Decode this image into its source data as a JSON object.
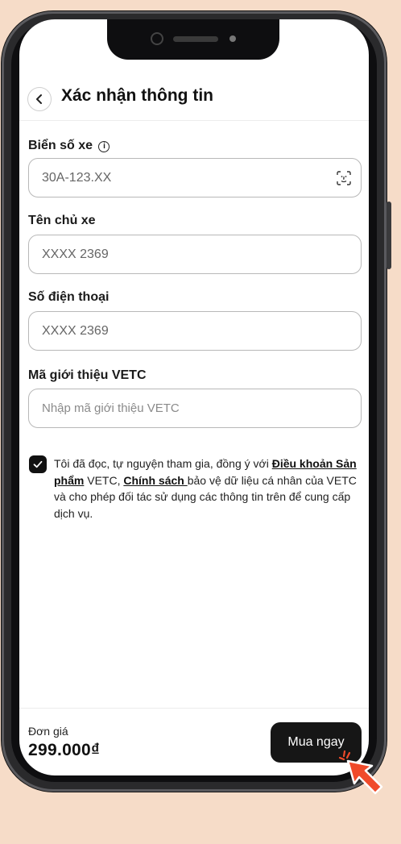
{
  "header": {
    "title": "Xác nhận thông tin"
  },
  "form": {
    "plate": {
      "label": "Biển số xe",
      "value": "30A-123.XX"
    },
    "owner": {
      "label": "Tên chủ xe",
      "value": "XXXX 2369"
    },
    "phone": {
      "label": "Số điện thoại",
      "value": "XXXX 2369"
    },
    "referral": {
      "label": "Mã giới thiệu VETC",
      "placeholder": "Nhập mã giới thiệu VETC"
    }
  },
  "consent": {
    "checked": true,
    "text_1": "Tôi đã đọc, tự nguyện tham gia, đồng ý với ",
    "link_terms": "Điều khoản Sản phẩm",
    "text_2": " VETC, ",
    "link_policy": "Chính sách ",
    "text_3": "bảo vệ dữ liệu cá nhân của VETC và cho phép đối tác sử dụng các thông tin trên để cung cấp dịch vụ."
  },
  "footer": {
    "price_label": "Đơn giá",
    "price_value": "299.000₫",
    "buy_label": "Mua ngay"
  },
  "colors": {
    "background": "#f6dcc8",
    "primary_button": "#161616",
    "cursor": "#f04a2a"
  },
  "icons": [
    "chevron-left-icon",
    "info-icon",
    "face-scan-icon",
    "checkmark-icon",
    "pointer-cursor-icon"
  ]
}
